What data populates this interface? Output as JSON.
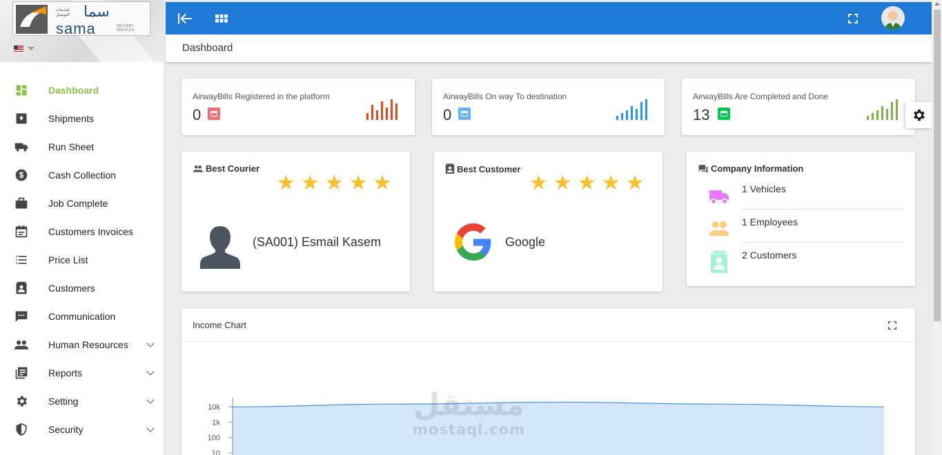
{
  "brand": {
    "logo_text": "sama",
    "logo_arabic": "سما",
    "logo_subtitle_ar": "لخدمات التوصيل",
    "logo_subtitle_en": "DELIVERY SERVICES",
    "language": "en-US"
  },
  "sidebar": {
    "items": [
      {
        "label": "Dashboard",
        "icon": "dashboard-icon",
        "active": true,
        "expandable": false
      },
      {
        "label": "Shipments",
        "icon": "inbox-icon",
        "active": false,
        "expandable": false
      },
      {
        "label": "Run Sheet",
        "icon": "truck-icon",
        "active": false,
        "expandable": false
      },
      {
        "label": "Cash Collection",
        "icon": "dollar-icon",
        "active": false,
        "expandable": false
      },
      {
        "label": "Job Complete",
        "icon": "briefcase-icon",
        "active": false,
        "expandable": false
      },
      {
        "label": "Customers Invoices",
        "icon": "calendar-icon",
        "active": false,
        "expandable": false
      },
      {
        "label": "Price List",
        "icon": "list-icon",
        "active": false,
        "expandable": false
      },
      {
        "label": "Customers",
        "icon": "contact-card-icon",
        "active": false,
        "expandable": false
      },
      {
        "label": "Communication",
        "icon": "chat-icon",
        "active": false,
        "expandable": false
      },
      {
        "label": "Human Resources",
        "icon": "people-icon",
        "active": false,
        "expandable": true
      },
      {
        "label": "Reports",
        "icon": "reports-icon",
        "active": false,
        "expandable": true
      },
      {
        "label": "Setting",
        "icon": "gear-icon",
        "active": false,
        "expandable": true
      },
      {
        "label": "Security",
        "icon": "shield-icon",
        "active": false,
        "expandable": true
      }
    ]
  },
  "topbar": {
    "color": "#1e7ad6",
    "collapse_icon": "collapse-left-icon",
    "apps_icon": "grid-icon",
    "fullscreen_icon": "fullscreen-icon"
  },
  "breadcrumb": "Dashboard",
  "stats": [
    {
      "title": "AirwayBills Registered in the platform",
      "value": "0",
      "color": "#e64a19",
      "badge": "#ef6e6e"
    },
    {
      "title": "AirwayBills On way To destination",
      "value": "0",
      "color": "#2196f3",
      "badge": "#64b5f6"
    },
    {
      "title": "AirwayBills Are Completed and Done",
      "value": "13",
      "color": "#7cb342",
      "badge": "#00c853"
    }
  ],
  "best_courier": {
    "title": "Best Courier",
    "name": "(SA001) Esmail Kasem",
    "rating": 5
  },
  "best_customer": {
    "title": "Best Customer",
    "name": "Google",
    "rating": 5
  },
  "company_info": {
    "title": "Company Information",
    "rows": [
      {
        "text": "1 Vehicles",
        "icon": "truck-icon",
        "color": "#e879f9"
      },
      {
        "text": "1 Employees",
        "icon": "people-icon",
        "color": "#ffcc80"
      },
      {
        "text": "2 Customers",
        "icon": "contact-card-icon",
        "color": "#a7f3d0"
      }
    ]
  },
  "income_chart": {
    "title": "Income Chart"
  },
  "chart_data": {
    "type": "area",
    "title": "Income Chart",
    "yscale": "log",
    "yticks": [
      "10k",
      "1k",
      "100",
      "10"
    ],
    "series": [
      {
        "values": [
          10000,
          15000,
          20000,
          15000,
          10000
        ]
      }
    ]
  },
  "watermark": {
    "ar": "مستقل",
    "en": "mostaql.com"
  }
}
